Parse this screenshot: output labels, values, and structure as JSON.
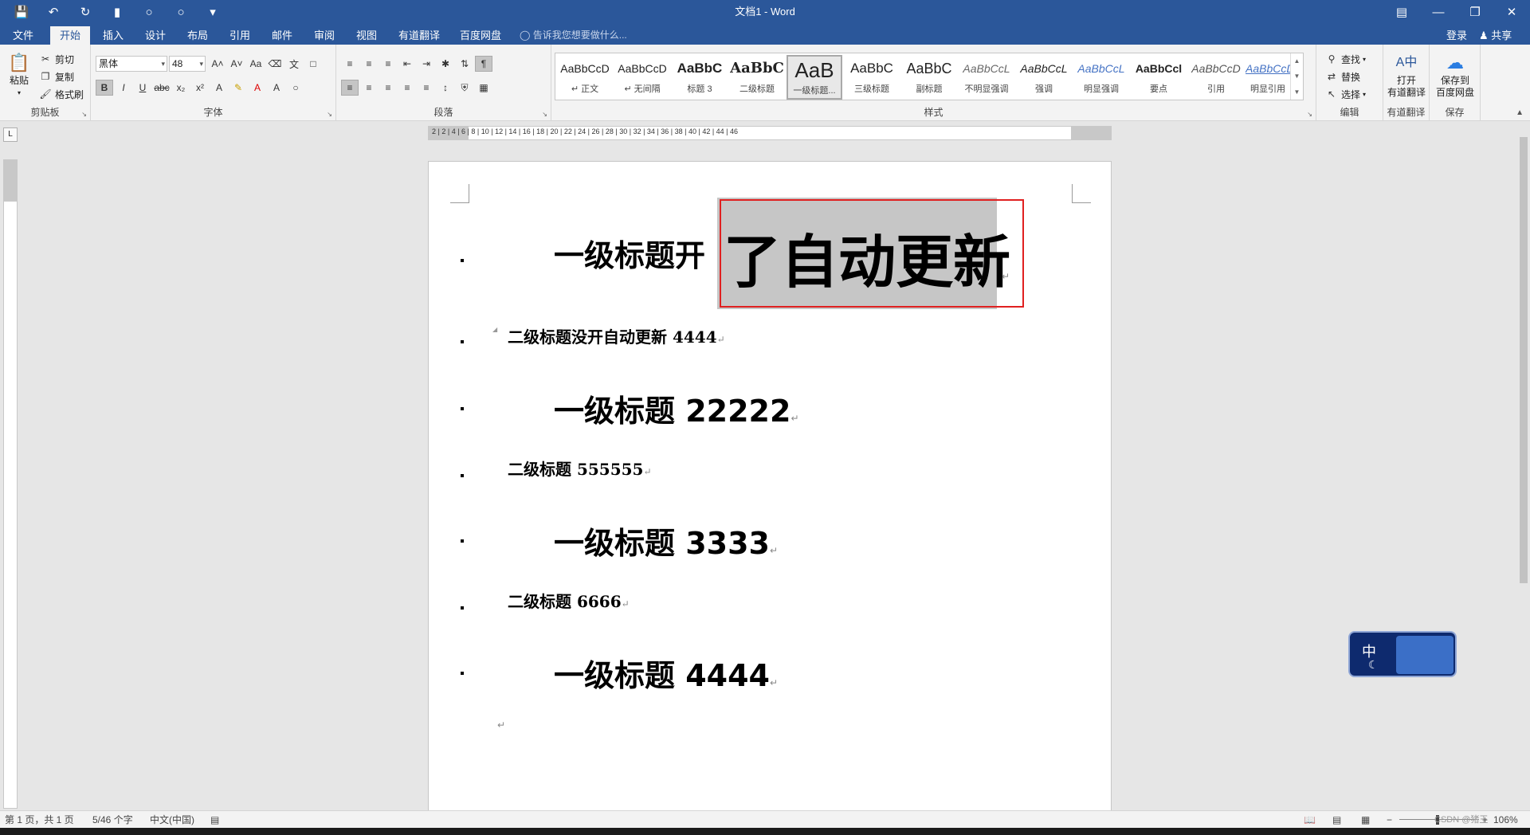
{
  "window": {
    "title": "文档1 - Word"
  },
  "tabs": [
    "文件",
    "开始",
    "插入",
    "设计",
    "布局",
    "引用",
    "邮件",
    "审阅",
    "视图",
    "有道翻译",
    "百度网盘"
  ],
  "active_tab": "开始",
  "tell_me": "告诉我您想要做什么...",
  "account": {
    "signin": "登录",
    "share": "共享"
  },
  "clipboard": {
    "paste": "粘贴",
    "cut": "剪切",
    "copy": "复制",
    "format_painter": "格式刷",
    "label": "剪贴板"
  },
  "font": {
    "name": "黑体",
    "size": "48",
    "label": "字体"
  },
  "paragraph": {
    "label": "段落"
  },
  "styles": {
    "label": "样式",
    "items": [
      {
        "sample": "AaBbCcD",
        "name": "↵ 正文"
      },
      {
        "sample": "AaBbCcD",
        "name": "↵ 无间隔"
      },
      {
        "sample": "AaBbC",
        "name": "标题 3"
      },
      {
        "sample": "AaBbC",
        "name": "二级标题"
      },
      {
        "sample": "AaB",
        "name": "一级标题..."
      },
      {
        "sample": "AaBbC",
        "name": "三级标题"
      },
      {
        "sample": "AaBbC",
        "name": "副标题"
      },
      {
        "sample": "AaBbCcL",
        "name": "不明显强调"
      },
      {
        "sample": "AaBbCcL",
        "name": "强调"
      },
      {
        "sample": "AaBbCcL",
        "name": "明显强调"
      },
      {
        "sample": "AaBbCcl",
        "name": "要点"
      },
      {
        "sample": "AaBbCcD",
        "name": "引用"
      },
      {
        "sample": "AaBbCcD",
        "name": "明显引用"
      }
    ]
  },
  "editing": {
    "find": "查找",
    "replace": "替换",
    "select": "选择",
    "label": "编辑"
  },
  "youdao": {
    "open": "打开",
    "translate": "有道翻译",
    "label": "有道翻译"
  },
  "baidu": {
    "save_to": "保存到",
    "pan": "百度网盘",
    "label": "保存"
  },
  "ruler": {
    "ticks": "2 | 2 | 4 | 6 | 8 | 10 | 12 | 14 | 16 | 18 | 20 | 22 | 24 | 26 | 28 | 30 | 32 | 34 | 36 | 38 | 40 | 42 | 44 | 46"
  },
  "document": {
    "big_heading_plain": "一级标题开",
    "big_heading_selected": "了自动更新",
    "lines": [
      {
        "level": 2,
        "text": "二级标题没开自动更新 4444"
      },
      {
        "level": 1,
        "text": "一级标题 22222"
      },
      {
        "level": 2,
        "text": "二级标题 555555"
      },
      {
        "level": 1,
        "text": "一级标题 3333"
      },
      {
        "level": 2,
        "text": "二级标题 6666"
      },
      {
        "level": 1,
        "text": "一级标题 4444"
      }
    ],
    "paragraph_mark": "↵"
  },
  "ime": {
    "mode": "中"
  },
  "status": {
    "page": "第 1 页，共 1 页",
    "words": "5/46 个字",
    "language": "中文(中国)",
    "zoom": "106%",
    "watermark": "CSDN @猪王"
  },
  "colors": {
    "brand": "#2b579a",
    "selection": "#c6c6c6",
    "annotation": "#e02020"
  }
}
